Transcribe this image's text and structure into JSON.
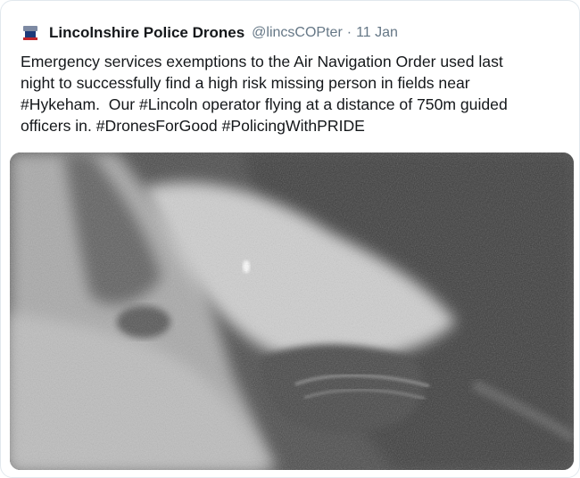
{
  "tweet": {
    "author_name": "Lincolnshire Police Drones",
    "handle": "@lincsCOPter",
    "separator": "·",
    "date": "11 Jan",
    "text": "Emergency services exemptions to the Air Navigation Order used last\nnight to successfully find a high risk missing person in fields near\n#Hykeham.  Our #Lincoln operator flying at a distance of 750m guided\nofficers in. #DronesForGood #PolicingWithPRIDE",
    "avatar_icon": "lincolnshire-police-logo-icon",
    "media": {
      "description_icon": "thermal-drone-image",
      "colors": {
        "dark": "#3a3a3a",
        "mid": "#7a7a7a",
        "light": "#d2d2d2"
      }
    }
  }
}
